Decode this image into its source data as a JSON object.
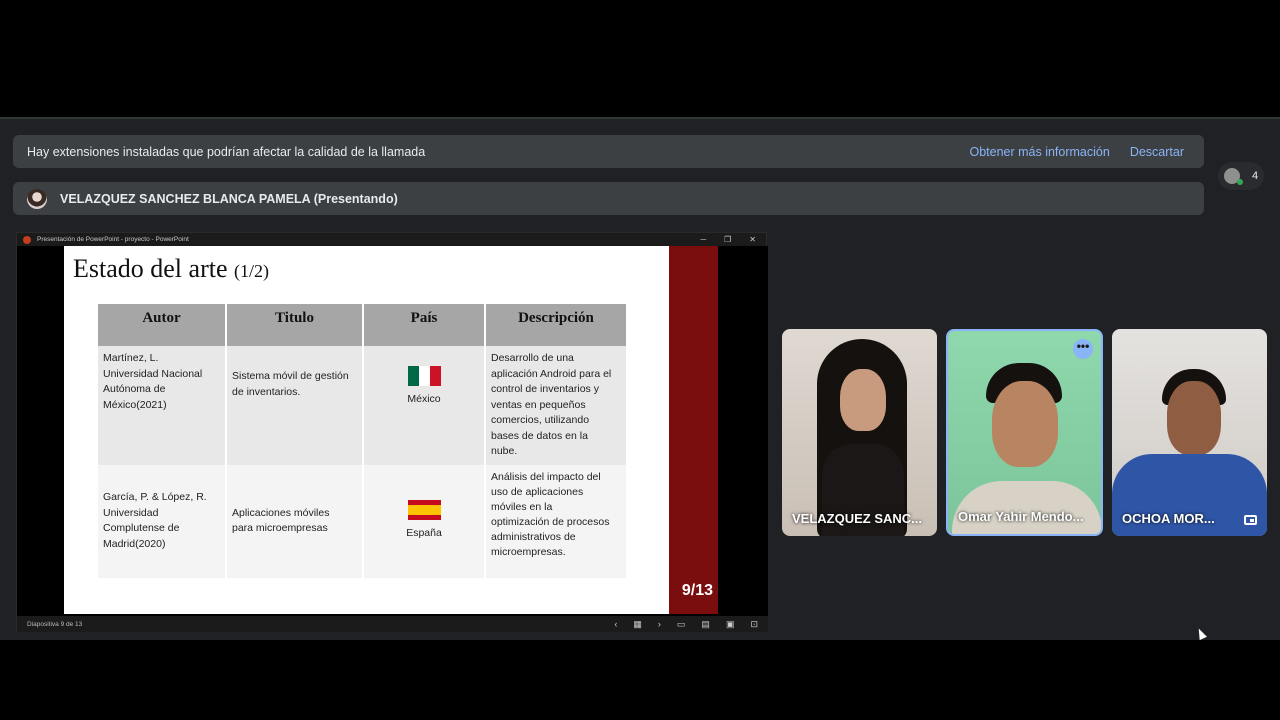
{
  "notice": {
    "text": "Hay extensiones instaladas que podrían afectar la calidad de la llamada",
    "learn_more": "Obtener más información",
    "dismiss": "Descartar"
  },
  "presenter": {
    "label": "VELAZQUEZ SANCHEZ BLANCA PAMELA (Presentando)"
  },
  "participants": {
    "count": "4"
  },
  "ppt": {
    "window_title": "Presentación de PowerPoint - proyecto - PowerPoint",
    "status": "Diapositiva 9 de 13"
  },
  "slide": {
    "title": "Estado del arte",
    "title_sub": "(1/2)",
    "number": "9/13",
    "headers": [
      "Autor",
      "Titulo",
      "País",
      "Descripción"
    ],
    "rows": [
      {
        "autor": [
          "Martínez, L.",
          "Universidad Nacional",
          "Autónoma de",
          "México(2021)"
        ],
        "titulo": [
          "Sistema móvil de gestión",
          "de inventarios."
        ],
        "pais": "México",
        "descripcion": [
          "Desarrollo de una",
          "aplicación Android para el",
          "control de inventarios y",
          "ventas en pequeños",
          "comercios, utilizando",
          "bases de datos en la",
          "nube."
        ]
      },
      {
        "autor": [
          "García, P. & López, R.",
          "Universidad",
          "Complutense de",
          "Madrid(2020)"
        ],
        "titulo": [
          "Aplicaciones móviles",
          "para microempresas"
        ],
        "pais": "España",
        "descripcion": [
          "Análisis del impacto del",
          "uso de aplicaciones",
          "móviles en la",
          "optimización de procesos",
          "administrativos de",
          "microempresas."
        ]
      }
    ]
  },
  "tiles": [
    {
      "name": "VELAZQUEZ SANC..."
    },
    {
      "name": "Omar Yahir Mendo..."
    },
    {
      "name": "OCHOA MOR..."
    }
  ],
  "colors": {
    "accent": "#8ab4f8",
    "slide_red": "#7a0d0d",
    "mexico_green": "#006847",
    "mexico_red": "#ce1126",
    "spain_red": "#c60b1e",
    "spain_yellow": "#ffc400"
  }
}
